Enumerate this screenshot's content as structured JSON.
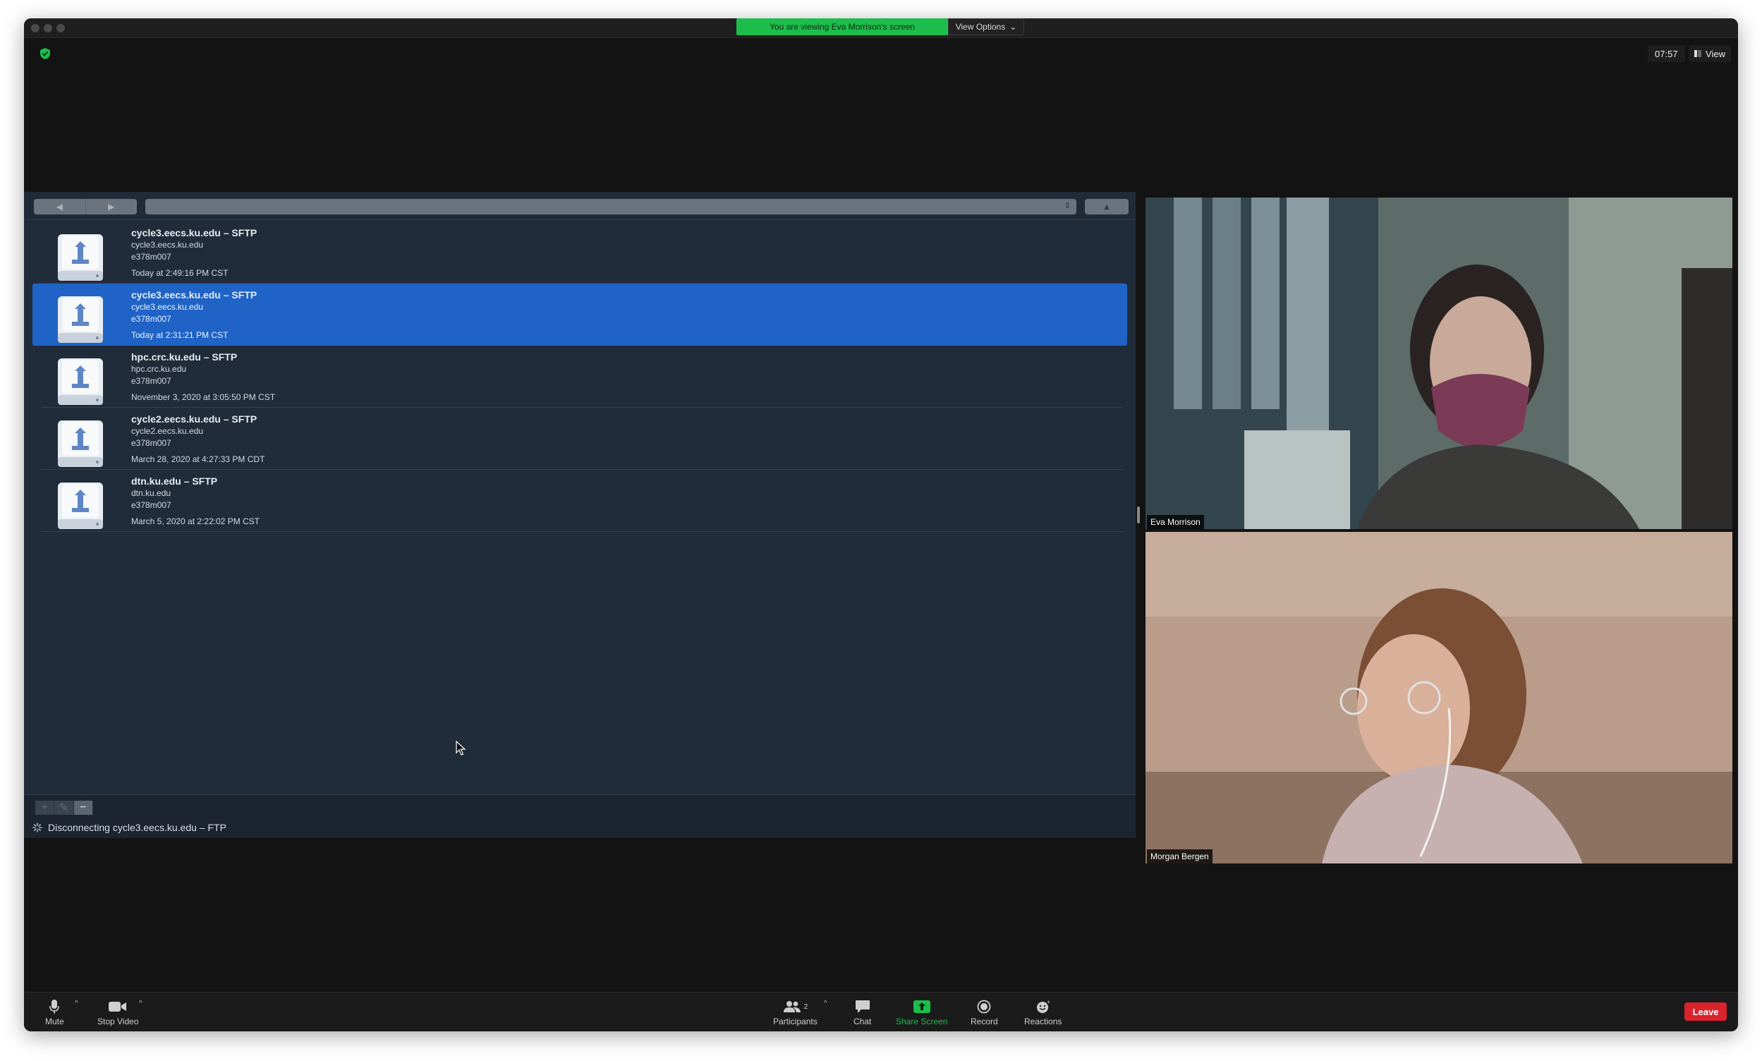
{
  "window": {
    "banner_text": "You are viewing Eva Morrison's screen",
    "view_options": "View Options",
    "clock": "07:57",
    "view_label": "View"
  },
  "sftp": {
    "connections": [
      {
        "title": "cycle3.eecs.ku.edu – SFTP",
        "host": "cycle3.eecs.ku.edu",
        "user": "e378m007",
        "date": "Today at 2:49:16 PM CST",
        "selected": false
      },
      {
        "title": "cycle3.eecs.ku.edu – SFTP",
        "host": "cycle3.eecs.ku.edu",
        "user": "e378m007",
        "date": "Today at 2:31:21 PM CST",
        "selected": true
      },
      {
        "title": "hpc.crc.ku.edu – SFTP",
        "host": "hpc.crc.ku.edu",
        "user": "e378m007",
        "date": "November 3, 2020 at 3:05:50 PM CST",
        "selected": false
      },
      {
        "title": "cycle2.eecs.ku.edu – SFTP",
        "host": "cycle2.eecs.ku.edu",
        "user": "e378m007",
        "date": "March 28, 2020 at 4:27:33 PM CDT",
        "selected": false
      },
      {
        "title": "dtn.ku.edu – SFTP",
        "host": "dtn.ku.edu",
        "user": "e378m007",
        "date": "March 5, 2020 at 2:22:02 PM CST",
        "selected": false
      }
    ],
    "status": "Disconnecting cycle3.eecs.ku.edu – FTP",
    "footer_buttons": [
      "+",
      "✎",
      "−"
    ]
  },
  "participants": {
    "video1_name": "Eva Morrison",
    "video2_name": "Morgan Bergen"
  },
  "controls": {
    "mute": "Mute",
    "stop_video": "Stop Video",
    "participants": "Participants",
    "participants_count": "2",
    "chat": "Chat",
    "share_screen": "Share Screen",
    "record": "Record",
    "reactions": "Reactions",
    "leave": "Leave"
  },
  "colors": {
    "banner_green": "#1dbd4b",
    "selection_blue": "#1f63c7",
    "leave_red": "#d9232d"
  }
}
